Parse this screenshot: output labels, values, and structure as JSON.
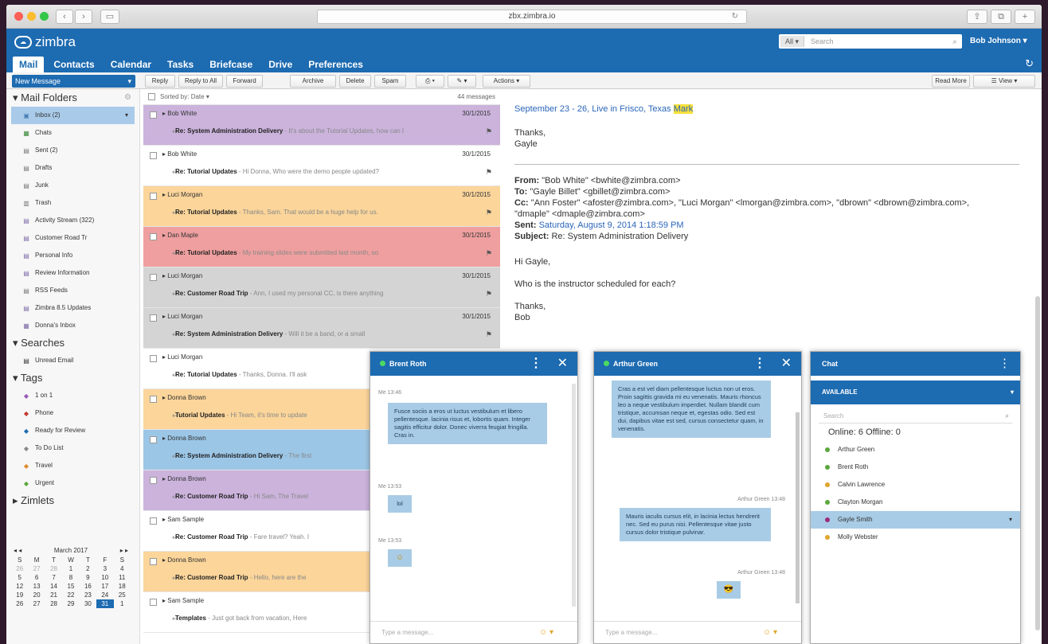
{
  "browser": {
    "url": "zbx.zimbra.io"
  },
  "app": {
    "logo_text": "zimbra",
    "search_type": "All",
    "search_placeholder": "Search",
    "user": "Bob Johnson"
  },
  "tabs": [
    "Mail",
    "Contacts",
    "Calendar",
    "Tasks",
    "Briefcase",
    "Drive",
    "Preferences"
  ],
  "toolbar": {
    "new_message": "New Message",
    "buttons": [
      "Reply",
      "Reply to All",
      "Forward",
      "Archive",
      "Delete",
      "Spam",
      "Actions"
    ],
    "read_more": "Read More",
    "view": "View"
  },
  "folders": {
    "header": "Mail Folders",
    "items": [
      {
        "label": "Inbox (2)",
        "icon": "inbox-icon"
      },
      {
        "label": "Chats",
        "icon": "chat-icon"
      },
      {
        "label": "Sent (2)",
        "icon": "sent-icon"
      },
      {
        "label": "Drafts",
        "icon": "drafts-icon"
      },
      {
        "label": "Junk",
        "icon": "junk-icon"
      },
      {
        "label": "Trash",
        "icon": "trash-icon"
      },
      {
        "label": "Activity Stream (322)",
        "icon": "folder-icon"
      },
      {
        "label": "Customer Road Tr",
        "icon": "folder-icon"
      },
      {
        "label": "Personal Info",
        "icon": "folder-icon"
      },
      {
        "label": "Review Information",
        "icon": "folder-icon"
      },
      {
        "label": "RSS Feeds",
        "icon": "rss-icon"
      },
      {
        "label": "Zimbra 8.5 Updates",
        "icon": "folder-icon"
      },
      {
        "label": "Donna's Inbox",
        "icon": "shared-folder-icon"
      }
    ]
  },
  "searches": {
    "header": "Searches",
    "items": [
      "Unread Email"
    ]
  },
  "tags": {
    "header": "Tags",
    "items": [
      {
        "label": "1 on 1",
        "color": "#9b59b6"
      },
      {
        "label": "Phone",
        "color": "#c0392b"
      },
      {
        "label": "Ready for Review",
        "color": "#1d6bb1"
      },
      {
        "label": "To Do List",
        "color": "#888888"
      },
      {
        "label": "Travel",
        "color": "#e08a2f"
      },
      {
        "label": "Urgent",
        "color": "#5aa83b"
      }
    ]
  },
  "zimlets": {
    "header": "Zimlets"
  },
  "calendar": {
    "month": "March 2017",
    "weekdays": [
      "S",
      "M",
      "T",
      "W",
      "T",
      "F",
      "S"
    ],
    "weeks": [
      [
        "26",
        "27",
        "28",
        "1",
        "2",
        "3",
        "4"
      ],
      [
        "5",
        "6",
        "7",
        "8",
        "9",
        "10",
        "11"
      ],
      [
        "12",
        "13",
        "14",
        "15",
        "16",
        "17",
        "18"
      ],
      [
        "19",
        "20",
        "21",
        "22",
        "23",
        "24",
        "25"
      ],
      [
        "26",
        "27",
        "28",
        "29",
        "30",
        "31",
        "1"
      ]
    ]
  },
  "message_list": {
    "sort": "Sorted by: Date",
    "count": "44 messages",
    "messages": [
      {
        "sender": "Bob White",
        "date": "30/1/2015",
        "subject": "Re: System Administration Delivery",
        "preview": "- It's about the Tutorial Updates, how can I",
        "bg": "#cbb3dc"
      },
      {
        "sender": "Bob White",
        "date": "30/1/2015",
        "subject": "Re: Tutorial Updates",
        "preview": "- Hi Donna, Who were the demo people updated?",
        "bg": "#ffffff"
      },
      {
        "sender": "Luci Morgan",
        "date": "30/1/2015",
        "subject": "Re: Tutorial Updates",
        "preview": "- Thanks, Sam. That would be a huge help for us.",
        "bg": "#fbd59a"
      },
      {
        "sender": "Dan Maple",
        "date": "30/1/2015",
        "subject": "Re: Tutorial Updates",
        "preview": "- My training slides were submitted last month, so",
        "bg": "#ef9f9f"
      },
      {
        "sender": "Luci Morgan",
        "date": "30/1/2015",
        "subject": "Re: Customer Road Trip",
        "preview": "- Ann, I used my personal CC, is there anything",
        "bg": "#d4d4d4"
      },
      {
        "sender": "Luci Morgan",
        "date": "30/1/2015",
        "subject": "Re: System Administration Delivery",
        "preview": "- Will it be a band, or a small",
        "bg": "#d4d4d4"
      },
      {
        "sender": "Luci Morgan",
        "date": "",
        "subject": "Re: Tutorial Updates",
        "preview": "- Thanks, Donna. I'll ask",
        "bg": "#ffffff"
      },
      {
        "sender": "Donna Brown",
        "date": "",
        "subject": "Tutorial Updates",
        "preview": "- Hi Team, it's time to update",
        "bg": "#fbd59a"
      },
      {
        "sender": "Donna Brown",
        "date": "",
        "subject": "Re: System Administration Delivery",
        "preview": "- The first",
        "bg": "#9cc6e6"
      },
      {
        "sender": "Donna Brown",
        "date": "",
        "subject": "Re: Customer Road Trip",
        "preview": "- Hi Sam, The Travel",
        "bg": "#cbb3dc"
      },
      {
        "sender": "Sam Sample",
        "date": "",
        "subject": "Re: Customer Road Trip",
        "preview": "- Fare travel? Yeah. I",
        "bg": "#ffffff"
      },
      {
        "sender": "Donna Brown",
        "date": "",
        "subject": "Re: Customer Road Trip",
        "preview": "- Hello, here are the",
        "bg": "#fbd59a"
      },
      {
        "sender": "Sam Sample",
        "date": "",
        "subject": "Templates",
        "preview": "- Just got back from vacation, Here",
        "bg": "#ffffff"
      }
    ]
  },
  "reading": {
    "top_line": "September 23 - 26, Live in Frisco, Texas",
    "top_highlight": "Mark",
    "thanks": "Thanks,",
    "gayle": "Gayle",
    "from_label": "From:",
    "from": "\"Bob White\" <bwhite@zimbra.com>",
    "to_label": "To:",
    "to": "\"Gayle Billet\" <gbillet@zimbra.com>",
    "cc_label": "Cc:",
    "cc": "\"Ann Foster\" <afoster@zimbra.com>, \"Luci Morgan\" <lmorgan@zimbra.com>, \"dbrown\" <dbrown@zimbra.com>, \"dmaple\" <dmaple@zimbra.com>",
    "sent_label": "Sent:",
    "sent": "Saturday, August 9, 2014 1:18:59 PM",
    "subject_label": "Subject:",
    "subject": "Re: System Administration Delivery",
    "greeting": "Hi Gayle,",
    "body": "Who is the instructor scheduled for each?",
    "sign_thanks": "Thanks,",
    "sign_name": "Bob"
  },
  "chat1": {
    "name": "Brent Roth",
    "meta1": "Me  13:46",
    "msg1": "Fusce sociis a eros ut luctus vestibulum et libero pellentesque. lacinia risus et, lobortis quam. Integer sagitis efficitur dolor. Donec viverra feugiat fringilla. Cras in.",
    "meta2": "Me  13:53",
    "msg2": "lol",
    "meta3": "Me  13:53",
    "emoji": "☺",
    "input": "Type a message..."
  },
  "chat2": {
    "name": "Arthur Green",
    "msg1": "Cras a est vel diam pellentesque luctus non ut eros. Proin sagittis gravida mi eu venenatis. Mauris rhoncus leo a neque vestibulum imperdiet. Nullam blandit cum tristique, accumsan neque et, egestas odio. Sed est dui, dapibus vitae est sed, cursus consectetur quam, in venenatis.",
    "meta2": "Arthur Green  13:48",
    "msg2": "Mauris iaculis cursus elit, in lacinia lectus hendrerit nec. Sed eu purus nisi. Pellentesque vitae justo cursus dolor tristique pulvinar.",
    "meta3": "Arthur Green  13:48",
    "emoji": "😎",
    "input": "Type a message..."
  },
  "chatlist": {
    "title": "Chat",
    "status": "AVAILABLE",
    "search": "Search",
    "online": "Online: 6 Offline: 0",
    "buddies": [
      {
        "name": "Arthur Green",
        "color": "#5aa83b"
      },
      {
        "name": "Brent Roth",
        "color": "#5aa83b"
      },
      {
        "name": "Calvin Lawrence",
        "color": "#e0a52f"
      },
      {
        "name": "Clayton Morgan",
        "color": "#5aa83b"
      },
      {
        "name": "Gayle Smith",
        "color": "#9b2c7b"
      },
      {
        "name": "Molly Webster",
        "color": "#e0a52f"
      }
    ]
  }
}
